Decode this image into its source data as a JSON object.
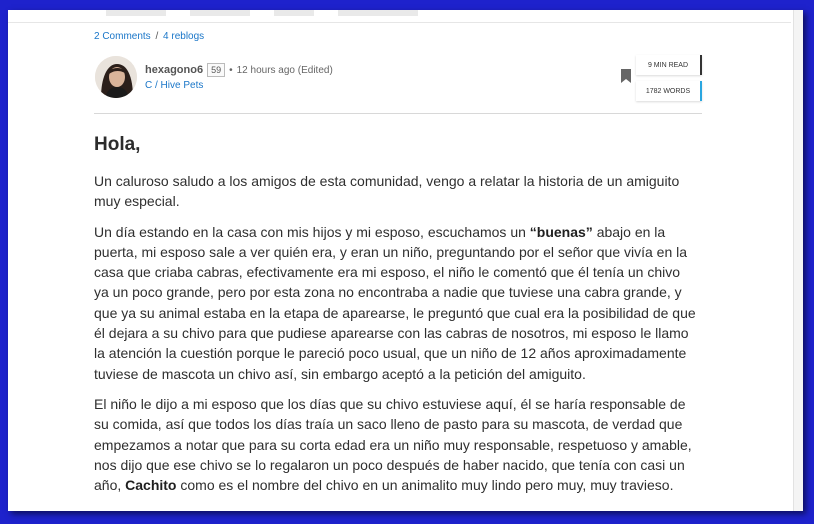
{
  "post": {
    "title_partial": "¿...................",
    "comments_link": "2 Comments",
    "separator": "/",
    "reblogs_link": "4 reblogs"
  },
  "author": {
    "name": "hexagono6",
    "reputation": "59",
    "bullet": "•",
    "time": "12 hours ago (Edited)",
    "community": "C / Hive Pets"
  },
  "stats": {
    "read_time": "9 MIN READ",
    "word_count": "1782 WORDS"
  },
  "content": {
    "heading": "Hola,",
    "p1": "Un caluroso saludo a los amigos de esta comunidad, vengo a relatar la historia de un amiguito muy especial.",
    "p2_before": "Un día estando en la casa con mis hijos y mi esposo, escuchamos un ",
    "p2_bold": "“buenas”",
    "p2_after": " abajo en la puerta, mi esposo sale a ver quién era, y eran un niño, preguntando por el señor que vivía en la casa que criaba cabras, efectivamente era mi esposo, el niño le comentó que él tenía un chivo ya un poco grande, pero por esta zona no encontraba a nadie que tuviese una cabra grande, y que ya su animal estaba en la etapa de aparearse, le preguntó que cual era la posibilidad de que él dejara a su chivo para que pudiese aparearse con las cabras de nosotros, mi esposo le llamo la atención la cuestión porque le pareció poco usual, que un niño de 12 años aproximadamente tuviese de mascota un chivo así, sin embargo aceptó a la petición del amiguito.",
    "p3_before": "El niño le dijo a mi esposo que los días que su chivo estuviese aquí, él se haría responsable de su comida, así que todos los días traía un saco lleno de pasto para su mascota, de verdad que empezamos a notar que para su corta edad era un niño muy responsable, respetuoso y amable, nos dijo que ese chivo se lo regalaron un poco después de haber nacido, que tenía con casi un año, ",
    "p3_bold": "Cachito",
    "p3_after": " como es el nombre del chivo en un animalito muy lindo pero muy, muy travieso."
  },
  "colors": {
    "frame_border": "#1e22cc",
    "link": "#1a76c8",
    "words_accent": "#2aa6e0"
  },
  "icons": [
    "avatar-photo",
    "bookmark-icon"
  ]
}
